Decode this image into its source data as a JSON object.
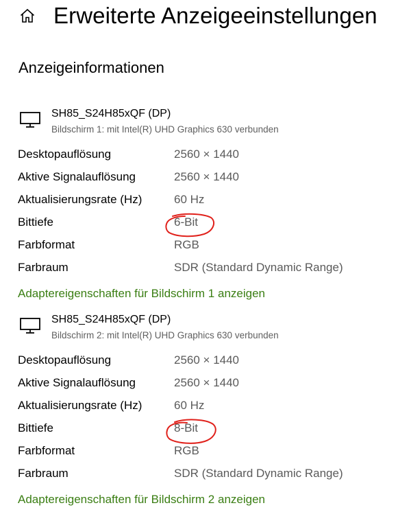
{
  "header": {
    "title": "Erweiterte Anzeigeeinstellungen",
    "home_icon": "home-icon"
  },
  "section": {
    "title": "Anzeigeinformationen"
  },
  "colors": {
    "link": "#3a7e13",
    "value": "#5a5a5a",
    "annotation": "#e0201a"
  },
  "monitors": [
    {
      "icon": "monitor-icon",
      "name": "SH85_S24H85xQF (DP)",
      "subtitle": "Bildschirm 1: mit Intel(R) UHD Graphics 630 verbunden",
      "rows": [
        {
          "label": "Desktopauflösung",
          "value": "2560 × 1440"
        },
        {
          "label": "Aktive Signalauflösung",
          "value": "2560 × 1440"
        },
        {
          "label": "Aktualisierungsrate (Hz)",
          "value": "60 Hz"
        },
        {
          "label": "Bittiefe",
          "value": "6-Bit"
        },
        {
          "label": "Farbformat",
          "value": "RGB"
        },
        {
          "label": "Farbraum",
          "value": "SDR (Standard Dynamic Range)"
        }
      ],
      "adapter_link": "Adaptereigenschaften für Bildschirm 1 anzeigen"
    },
    {
      "icon": "monitor-icon",
      "name": "SH85_S24H85xQF (DP)",
      "subtitle": "Bildschirm 2: mit Intel(R) UHD Graphics 630 verbunden",
      "rows": [
        {
          "label": "Desktopauflösung",
          "value": "2560 × 1440"
        },
        {
          "label": "Aktive Signalauflösung",
          "value": "2560 × 1440"
        },
        {
          "label": "Aktualisierungsrate (Hz)",
          "value": "60 Hz"
        },
        {
          "label": "Bittiefe",
          "value": "8-Bit"
        },
        {
          "label": "Farbformat",
          "value": "RGB"
        },
        {
          "label": "Farbraum",
          "value": "SDR (Standard Dynamic Range)"
        }
      ],
      "adapter_link": "Adaptereigenschaften für Bildschirm 2 anzeigen"
    }
  ]
}
